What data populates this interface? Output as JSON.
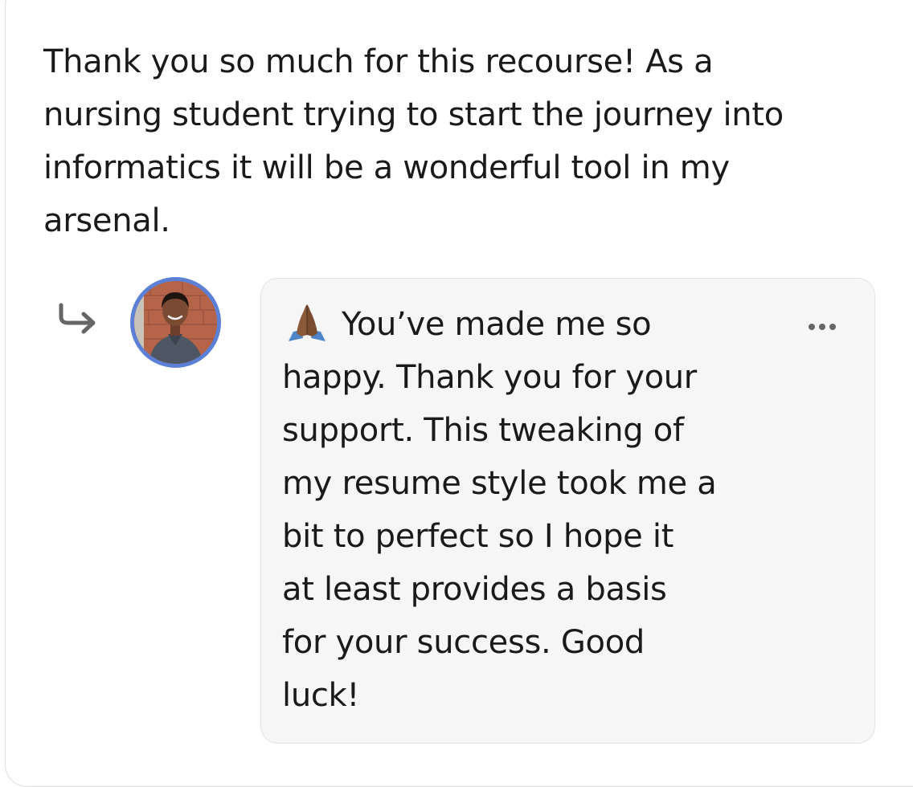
{
  "comment": {
    "text": "Thank you so much for this recourse! As a\nnursing student trying to start the journey into\ninformatics it will be a wonderful tool in my\narsenal."
  },
  "reply": {
    "icon": "reply-arrow-icon",
    "avatar": "avatar-photo",
    "emoji": "folded-hands-icon",
    "text": "You’ve made me so\nhappy. Thank you for your\nsupport. This tweaking of\nmy resume style took me a\nbit to perfect so I hope it\nat least provides a basis\nfor your success. Good\nluck!",
    "more_icon": "more-options-icon"
  },
  "colors": {
    "text": "#1a1a1a",
    "avatar_ring": "#5b80d6",
    "bubble_bg": "#f6f6f6",
    "bubble_border": "#e2e2e2",
    "icon_gray": "#666666"
  }
}
